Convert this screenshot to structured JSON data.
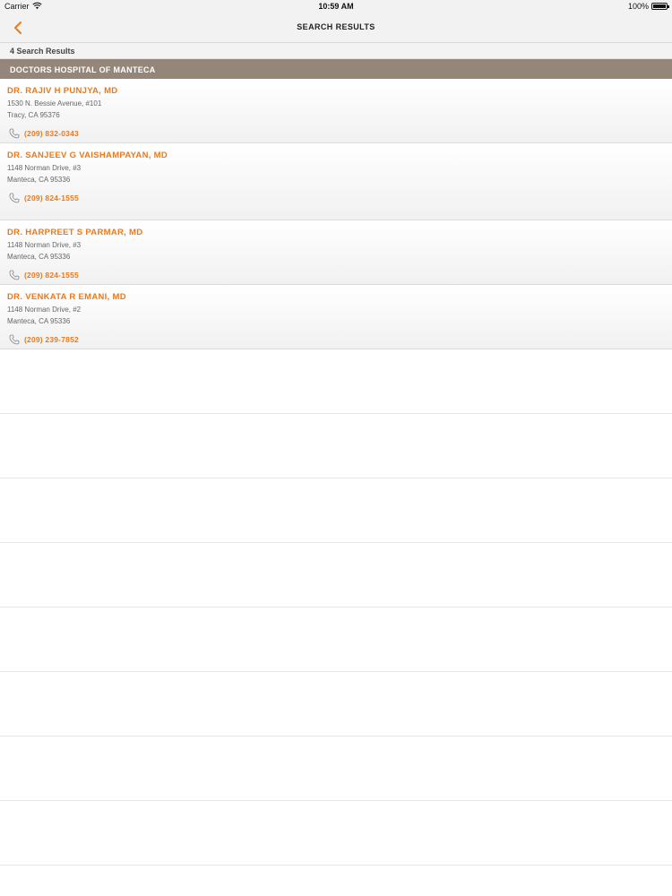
{
  "status_bar": {
    "carrier": "Carrier",
    "time": "10:59 AM",
    "battery": "100%"
  },
  "nav": {
    "title": "SEARCH RESULTS",
    "back_icon": "chevron-left-icon"
  },
  "results_count": "4 Search Results",
  "section": {
    "title": "DOCTORS HOSPITAL OF MANTECA"
  },
  "doctors": [
    {
      "name": "DR. RAJIV H PUNJYA, MD",
      "address_line1": "1530 N. Bessie Avenue, #101",
      "address_line2": "Tracy, CA 95376",
      "phone": "(209) 832-0343"
    },
    {
      "name": "DR. SANJEEV G VAISHAMPAYAN, MD",
      "address_line1": "1148 Norman Drive, #3",
      "address_line2": "Manteca, CA 95336",
      "phone": "(209) 824-1555"
    },
    {
      "name": "DR. HARPREET S PARMAR, MD",
      "address_line1": "1148 Norman Drive, #3",
      "address_line2": "Manteca, CA 95336",
      "phone": "(209) 824-1555"
    },
    {
      "name": "DR. VENKATA R EMANI, MD",
      "address_line1": "1148 Norman Drive, #2",
      "address_line2": "Manteca, CA 95336",
      "phone": "(209) 239-7852"
    }
  ],
  "colors": {
    "accent": "#e87a1e",
    "section_header_bg": "#948779"
  },
  "phone_icon": "phone-icon"
}
